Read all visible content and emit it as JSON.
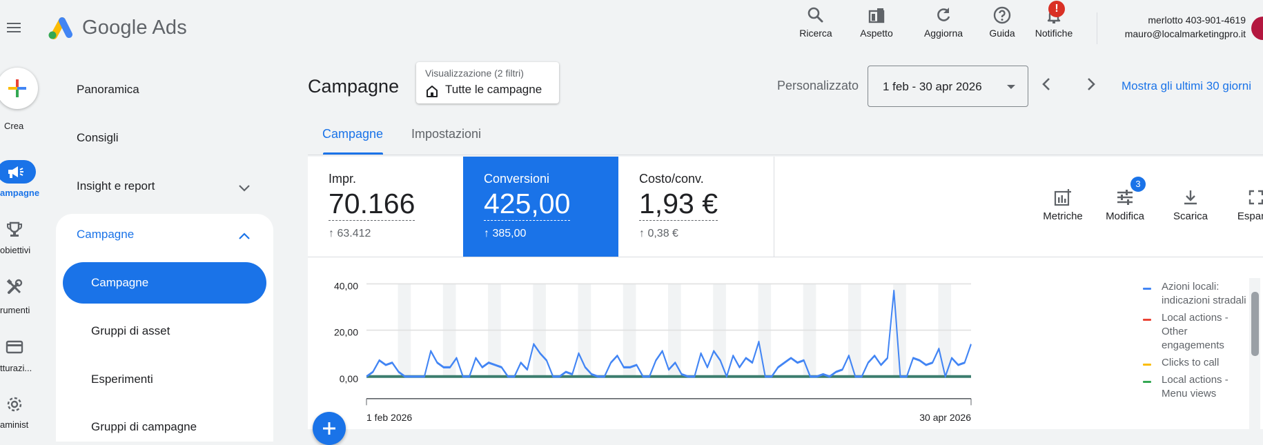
{
  "app": {
    "brand": "Google Ads"
  },
  "topbar": {
    "buttons": [
      {
        "label": "Ricerca",
        "icon": "search-icon"
      },
      {
        "label": "Aspetto",
        "icon": "appearance-icon"
      },
      {
        "label": "Aggiorna",
        "icon": "refresh-icon"
      },
      {
        "label": "Guida",
        "icon": "help-icon"
      },
      {
        "label": "Notifiche",
        "icon": "bell-icon"
      }
    ],
    "notification_badge": "!",
    "account_name": "merlotto 403-901-4619",
    "account_email": "mauro@localmarketingpro.it"
  },
  "rail": {
    "create_label": "Crea",
    "items": [
      {
        "label": "ampagne",
        "icon": "megaphone-icon"
      },
      {
        "label": "obiettivi",
        "icon": "trophy-icon"
      },
      {
        "label": "rumenti",
        "icon": "tools-icon"
      },
      {
        "label": "tturazi...",
        "icon": "credit-card-icon"
      },
      {
        "label": "aminist",
        "icon": "gear-icon"
      }
    ]
  },
  "nav": {
    "items": [
      "Panoramica",
      "Consigli",
      "Insight e report"
    ],
    "group_label": "Campagne",
    "active_item": "Campagne",
    "sub_items": [
      "Gruppi di asset",
      "Esperimenti",
      "Gruppi di campagne"
    ]
  },
  "header": {
    "title": "Campagne",
    "view_filter_top": "Visualizzazione (2 filtri)",
    "view_filter_main": "Tutte le campagne",
    "date_label": "Personalizzato",
    "date_range": "1 feb - 30 apr 2026",
    "show_last_link": "Mostra gli ultimi 30 giorni"
  },
  "tabs": [
    {
      "label": "Campagne",
      "active": true
    },
    {
      "label": "Impostazioni",
      "active": false
    }
  ],
  "metrics": [
    {
      "title": "Impr.",
      "value": "70.166",
      "delta": "↑ 63.412",
      "active": false
    },
    {
      "title": "Conversioni",
      "value": "425,00",
      "delta": "↑ 385,00",
      "active": true
    },
    {
      "title": "Costo/conv.",
      "value": "1,93 €",
      "delta": "↑ 0,38 €",
      "active": false
    }
  ],
  "tools": [
    {
      "label": "Metriche",
      "icon": "metrics-icon"
    },
    {
      "label": "Modifica",
      "icon": "tune-icon",
      "badge": "3"
    },
    {
      "label": "Scarica",
      "icon": "download-icon"
    },
    {
      "label": "Espandi",
      "icon": "fullscreen-icon"
    }
  ],
  "chart_data": {
    "type": "line",
    "x_start_label": "1 feb 2026",
    "x_end_label": "30 apr 2026",
    "y_ticks": [
      "40,00",
      "20,00",
      "0,00"
    ],
    "ylim": [
      0,
      40
    ],
    "grid": true,
    "legend_position": "right",
    "series": [
      {
        "name": "Azioni locali: indicazioni stradali",
        "color": "#4285f4",
        "values": [
          0,
          2,
          7,
          5,
          6,
          2,
          0,
          0,
          0,
          0,
          11,
          6,
          4,
          4,
          8,
          0,
          0,
          8,
          4,
          6,
          5,
          4,
          0,
          0,
          6,
          3,
          14,
          10,
          7,
          0,
          0,
          2,
          1,
          10,
          4,
          1,
          0,
          0,
          6,
          9,
          4,
          4,
          5,
          0,
          0,
          7,
          11,
          3,
          6,
          1,
          0,
          0,
          10,
          4,
          11,
          7,
          0,
          9,
          4,
          8,
          6,
          15,
          0,
          0,
          4,
          6,
          8,
          6,
          7,
          0,
          0,
          1,
          0,
          2,
          3,
          9,
          0,
          0,
          6,
          9,
          5,
          8,
          37,
          0,
          0,
          8,
          7,
          5,
          6,
          12,
          0,
          8,
          5,
          6,
          14
        ]
      },
      {
        "name": "Local actions - Other engagements",
        "color": "#ea4335",
        "values": [
          0
        ]
      },
      {
        "name": "Clicks to call",
        "color": "#fbbc04",
        "values": [
          0
        ]
      },
      {
        "name": "Local actions - Menu views",
        "color": "#34a853",
        "values": [
          0
        ]
      }
    ]
  }
}
